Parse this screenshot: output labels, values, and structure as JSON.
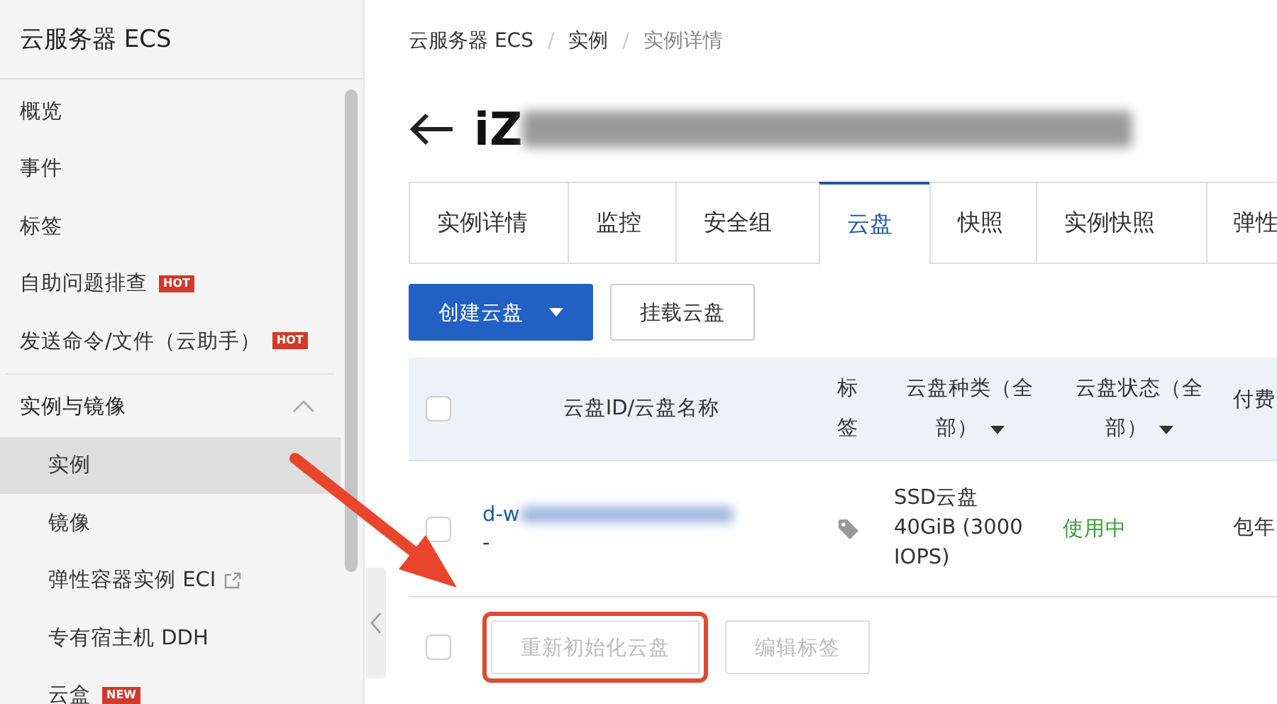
{
  "sidebar": {
    "title": "云服务器 ECS",
    "items": [
      {
        "label": "概览",
        "selected": false
      },
      {
        "label": "事件",
        "selected": false
      },
      {
        "label": "标签",
        "selected": false
      },
      {
        "label": "自助问题排查",
        "badge": "HOT",
        "selected": false
      },
      {
        "label": "发送命令/文件（云助手）",
        "badge": "HOT",
        "selected": false
      }
    ],
    "group": {
      "label": "实例与镜像",
      "expanded": true,
      "items": [
        {
          "label": "实例",
          "selected": true
        },
        {
          "label": "镜像",
          "selected": false
        },
        {
          "label": "弹性容器实例 ECI",
          "external": true,
          "selected": false
        },
        {
          "label": "专有宿主机 DDH",
          "selected": false
        },
        {
          "label": "云盒",
          "badge": "NEW",
          "selected": false
        }
      ]
    }
  },
  "breadcrumb": [
    {
      "kind": "link",
      "text": "云服务器 ECS"
    },
    {
      "kind": "separator",
      "text": "/"
    },
    {
      "kind": "link",
      "text": "实例"
    },
    {
      "kind": "separator",
      "text": "/"
    },
    {
      "kind": "current",
      "text": "实例详情"
    }
  ],
  "page_title": {
    "text": "iZ",
    "redacted": true
  },
  "tabs": [
    {
      "label": "实例详情",
      "selected": false
    },
    {
      "label": "监控",
      "selected": false
    },
    {
      "label": "安全组",
      "selected": false
    },
    {
      "label": "云盘",
      "selected": true
    },
    {
      "label": "快照",
      "selected": false
    },
    {
      "label": "实例快照",
      "selected": false
    },
    {
      "label": "弹性",
      "selected": false
    }
  ],
  "actions": [
    {
      "label": "创建云盘",
      "kind": "primary-split"
    },
    {
      "label": "挂载云盘",
      "kind": "default"
    }
  ],
  "table": {
    "header_checked": false,
    "columns": [
      {
        "label": "云盘ID/云盘名称"
      },
      {
        "label": "标签"
      },
      {
        "label": "云盘种类（全部）",
        "filter": true
      },
      {
        "label": "云盘状态（全部）",
        "filter": true
      },
      {
        "label": "付费"
      }
    ],
    "rows": [
      {
        "checked": false,
        "id": "d-w",
        "id_redacted": true,
        "name": "-",
        "type": "SSD云盘 40GiB (3000 IOPS)",
        "status": "使用中",
        "billing": "包年"
      }
    ]
  },
  "batch": {
    "checked": false,
    "buttons": [
      {
        "label": "重新初始化云盘",
        "disabled": true,
        "highlighted": true
      },
      {
        "label": "编辑标签",
        "disabled": true,
        "highlighted": false
      }
    ]
  },
  "annotation": {
    "arrow": true
  }
}
